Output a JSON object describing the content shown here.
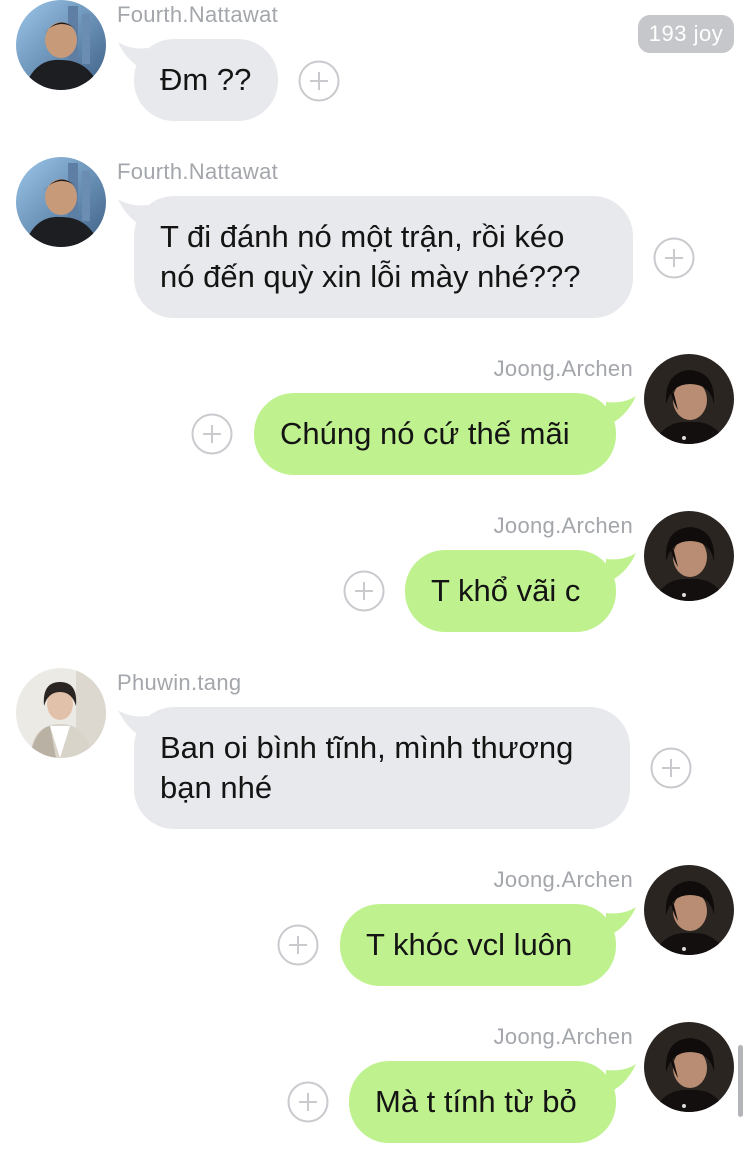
{
  "badge": "193 joy",
  "messages": [
    {
      "sender": "Fourth.Nattawat",
      "lines": [
        "Đm ??"
      ]
    },
    {
      "sender": "Fourth.Nattawat",
      "lines": [
        "T đi đánh nó một trận, rồi kéo",
        "nó đến quỳ xin lỗi mày nhé???"
      ]
    },
    {
      "sender": "Joong.Archen",
      "lines": [
        "Chúng nó cứ thế mãi"
      ]
    },
    {
      "sender": "Joong.Archen",
      "lines": [
        "T khổ vãi c"
      ]
    },
    {
      "sender": "Phuwin.tang",
      "lines": [
        "Ban oi bình tĩnh, mình thương",
        "bạn nhé"
      ]
    },
    {
      "sender": "Joong.Archen",
      "lines": [
        "T khóc vcl luôn"
      ]
    },
    {
      "sender": "Joong.Archen",
      "lines": [
        "Mà t tính từ bỏ"
      ]
    }
  ],
  "colors": {
    "incoming_bubble": "#e8e9ec",
    "outgoing_bubble": "#bff28f",
    "sender_name": "#a3a6ab"
  },
  "icons": {
    "add_reaction": "plus-circle-icon"
  }
}
